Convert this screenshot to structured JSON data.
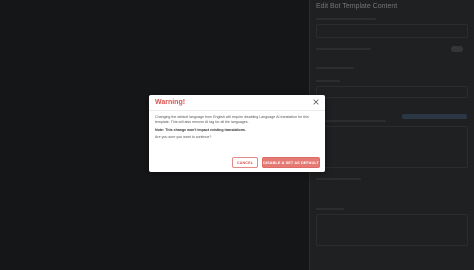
{
  "side_panel": {
    "title": "Edit Bot Template Content"
  },
  "dialog": {
    "title": "Warning!",
    "message": "Changing the default language from English will require disabling Language AI translation for this template. This will also remove AI tag for all the languages.",
    "note": "Note: This change won't impact existing translations.",
    "question": "Are you sure you want to continue?",
    "cancel_label": "CANCEL",
    "confirm_label": "DISABLE & SET AS DEFAULT"
  },
  "colors": {
    "warning": "#d9534f",
    "confirm_bg": "#e57a74",
    "panel_bg": "#2a2b2d"
  },
  "icons": {
    "close": "close-icon"
  }
}
